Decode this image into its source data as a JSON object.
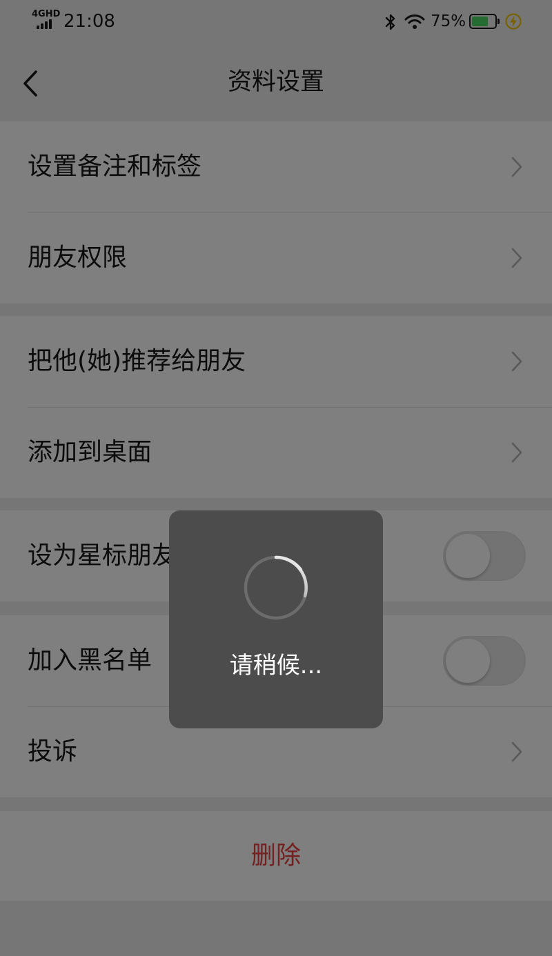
{
  "status_bar": {
    "network_type": "4GHD",
    "time": "21:08",
    "battery_percent": "75%",
    "battery_level": 0.75,
    "icons": [
      "signal-icon",
      "bluetooth-icon",
      "wifi-icon",
      "battery-icon",
      "charging-icon"
    ]
  },
  "nav": {
    "back_icon": "chevron-left-icon",
    "title": "资料设置"
  },
  "groups": [
    [
      {
        "label": "设置备注和标签",
        "accessory": "chevron-right-icon"
      },
      {
        "label": "朋友权限",
        "accessory": "chevron-right-icon"
      }
    ],
    [
      {
        "label": "把他(她)推荐给朋友",
        "accessory": "chevron-right-icon"
      },
      {
        "label": "添加到桌面",
        "accessory": "chevron-right-icon"
      }
    ],
    [
      {
        "label": "设为星标朋友",
        "accessory": "toggle",
        "on": false
      }
    ],
    [
      {
        "label": "加入黑名单",
        "accessory": "toggle",
        "on": false
      },
      {
        "label": "投诉",
        "accessory": "chevron-right-icon"
      }
    ]
  ],
  "delete_button": {
    "label": "删除",
    "color": "#e64340"
  },
  "loading_toast": {
    "text": "请稍候...",
    "icon": "spinner-icon"
  },
  "colors": {
    "background": "#ededed",
    "cell": "#ffffff",
    "accent_green": "#4cd964",
    "charge_yellow": "#f2c200",
    "destructive": "#e64340",
    "toast": "#4c4c4c"
  }
}
